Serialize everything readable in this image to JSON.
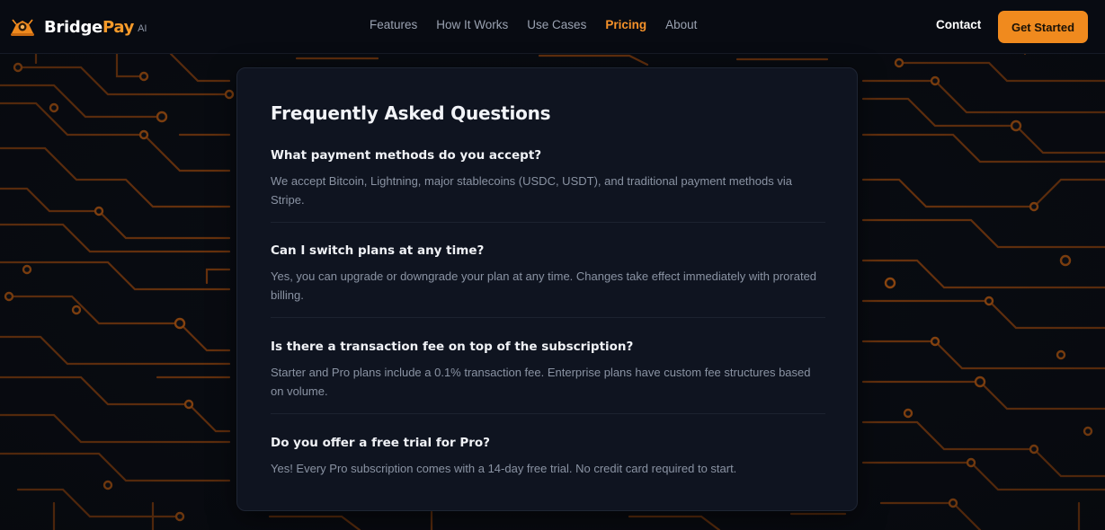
{
  "brand": {
    "name_main": "Bridge",
    "name_accent": "Pay",
    "suffix": "AI"
  },
  "nav": {
    "items": [
      {
        "label": "Features"
      },
      {
        "label": "How It Works"
      },
      {
        "label": "Use Cases"
      },
      {
        "label": "Pricing",
        "active": true
      },
      {
        "label": "About"
      }
    ],
    "contact_label": "Contact",
    "cta_label": "Get Started"
  },
  "faq": {
    "title": "Frequently Asked Questions",
    "items": [
      {
        "question": "What payment methods do you accept?",
        "answer": "We accept Bitcoin, Lightning, major stablecoins (USDC, USDT), and traditional payment methods via Stripe."
      },
      {
        "question": "Can I switch plans at any time?",
        "answer": "Yes, you can upgrade or downgrade your plan at any time. Changes take effect immediately with prorated billing."
      },
      {
        "question": "Is there a transaction fee on top of the subscription?",
        "answer": "Starter and Pro plans include a 0.1% transaction fee. Enterprise plans have custom fee structures based on volume."
      },
      {
        "question": "Do you offer a free trial for Pro?",
        "answer": "Yes! Every Pro subscription comes with a 14-day free trial. No credit card required to start."
      }
    ]
  },
  "theme": {
    "accent": "#f08a1e",
    "background": "#090c12",
    "card": "#0f1420"
  }
}
